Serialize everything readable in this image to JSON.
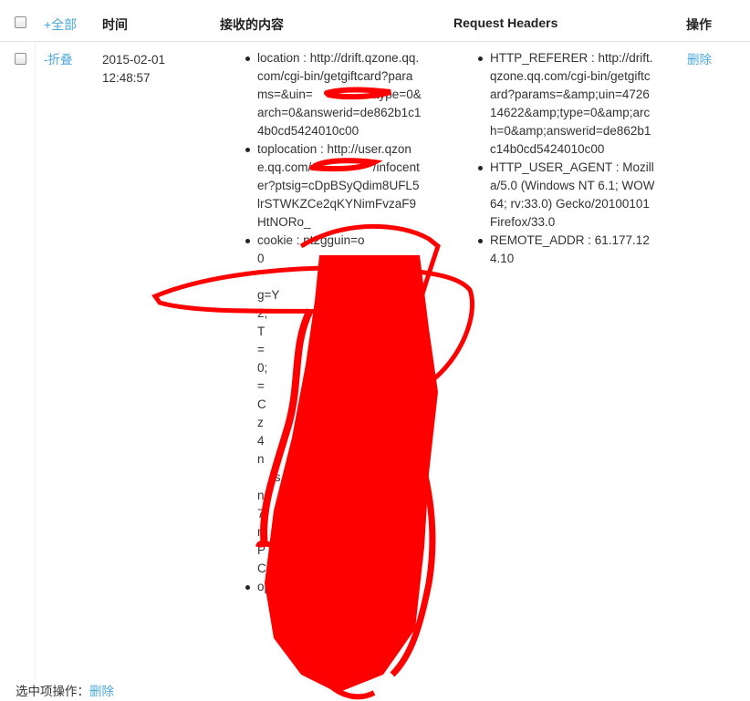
{
  "header": {
    "select_all_label": "+全部",
    "col_time": "时间",
    "col_content": "接收的内容",
    "col_headers": "Request Headers",
    "col_action": "操作"
  },
  "row": {
    "fold_label": "-折叠",
    "date": "2015-02-01",
    "time": "12:48:57",
    "content_items": [
      "location : http://drift.qzone.qq.com/cgi-bin/getgiftcard?params=&uin=                &type=0&arch=0&answerid=de862b1c14b0cd5424010c00",
      "toplocation : http://user.qzone.qq.com/                  /infocenter?ptsig=cDpBSyQdim8UFL5lrSTWKZCe2qKYNimFvzaF9HtNORo_",
      "cookie : pt2gguin=o0                                                                                  Loading=Y                    4223112;                    UPPORT                    ce_v8=                      4950;                       1; uin=                    @mC                       r=qz                       _14                        uin                        c                         s                         on                        227                       gJr                       dP                        =pC                       ",
      "opene"
    ],
    "header_items": [
      "HTTP_REFERER : http://drift.qzone.qq.com/cgi-bin/getgiftcard?params=&amp;uin=472614622&amp;type=0&amp;arch=0&amp;answerid=de862b1c14b0cd5424010c00",
      "HTTP_USER_AGENT : Mozilla/5.0 (Windows NT 6.1; WOW64; rv:33.0) Gecko/20100101 Firefox/33.0",
      "REMOTE_ADDR : 61.177.124.10"
    ],
    "delete_label": "删除"
  },
  "footer": {
    "label": "选中项操作：",
    "delete_label": "删除"
  },
  "colors": {
    "link": "#4aa8d8",
    "redaction": "#ff0000",
    "border": "#e2e2e2"
  }
}
